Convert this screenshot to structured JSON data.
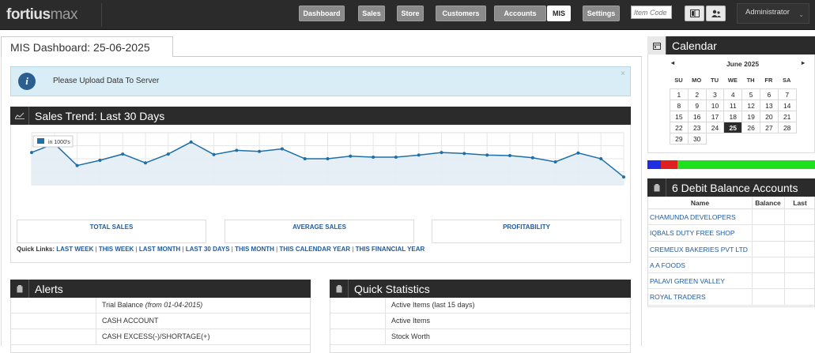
{
  "header": {
    "logo_main": "fortius",
    "logo_sub": "max",
    "nav": [
      {
        "label": "Dashboard",
        "active": false
      },
      {
        "label": "Sales",
        "active": false
      },
      {
        "label": "Store",
        "active": false
      },
      {
        "label": "Customers",
        "active": false
      },
      {
        "label": "Accounts",
        "active": false
      },
      {
        "label": "MIS",
        "active": true
      },
      {
        "label": "Settings",
        "active": false
      }
    ],
    "item_code_placeholder": "Item Code",
    "user": "Administrator"
  },
  "page": {
    "title": "MIS Dashboard: 25-06-2025"
  },
  "alert_info": {
    "message": "Please Upload Data To Server",
    "close": "×"
  },
  "sales_trend": {
    "title": "Sales Trend: Last 30 Days",
    "stats": [
      "TOTAL SALES",
      "AVERAGE SALES",
      "PROFITABILITY"
    ],
    "quick_links_label": "Quick Links:",
    "quick_links": [
      "LAST WEEK",
      "THIS WEEK",
      "LAST MONTH",
      "LAST 30 DAYS",
      "THIS MONTH",
      "THIS CALENDAR YEAR",
      "THIS FINANCIAL YEAR"
    ]
  },
  "chart_data": {
    "type": "area",
    "legend": "in 1000's",
    "values": [
      0.62,
      0.79,
      0.37,
      0.47,
      0.59,
      0.42,
      0.59,
      0.82,
      0.58,
      0.66,
      0.64,
      0.69,
      0.5,
      0.5,
      0.55,
      0.53,
      0.53,
      0.57,
      0.62,
      0.6,
      0.57,
      0.56,
      0.52,
      0.44,
      0.61,
      0.5,
      0.15
    ],
    "ylim": [
      0,
      1
    ],
    "grid": true,
    "colors": {
      "line": "#1f6fa8",
      "fill": "#e3edf5"
    }
  },
  "alerts": {
    "title": "Alerts",
    "rows": [
      {
        "text": "Trial Balance",
        "note": "(from 01-04-2015)"
      },
      {
        "text": "CASH ACCOUNT",
        "note": ""
      },
      {
        "text": "CASH EXCESS(-)/SHORTAGE(+)",
        "note": ""
      }
    ]
  },
  "quick_stats": {
    "title": "Quick Statistics",
    "rows": [
      "Active Items (last 15 days)",
      "Active Items",
      "Stock Worth"
    ]
  },
  "calendar": {
    "title": "Calendar",
    "month": "June 2025",
    "prev": "◂",
    "next": "▸",
    "dow": [
      "SU",
      "MO",
      "TU",
      "WE",
      "TH",
      "FR",
      "SA"
    ],
    "first_weekday": 0,
    "days_in_month": 30,
    "today": 25
  },
  "progress": {
    "segments": [
      {
        "color": "#1f2ee0",
        "percent": 8
      },
      {
        "color": "#e01f1f",
        "percent": 10
      },
      {
        "color": "#1fe01f",
        "percent": 82
      }
    ]
  },
  "debit": {
    "title": "6 Debit Balance Accounts",
    "columns": [
      "Name",
      "Balance",
      "Last"
    ],
    "rows": [
      "CHAMUNDA DEVELOPERS",
      "IQBALS DUTY FREE SHOP",
      "CREMEUX BAKERIES PVT LTD",
      "A A FOODS",
      "PALAVI GREEN VALLEY",
      "ROYAL TRADERS"
    ]
  }
}
